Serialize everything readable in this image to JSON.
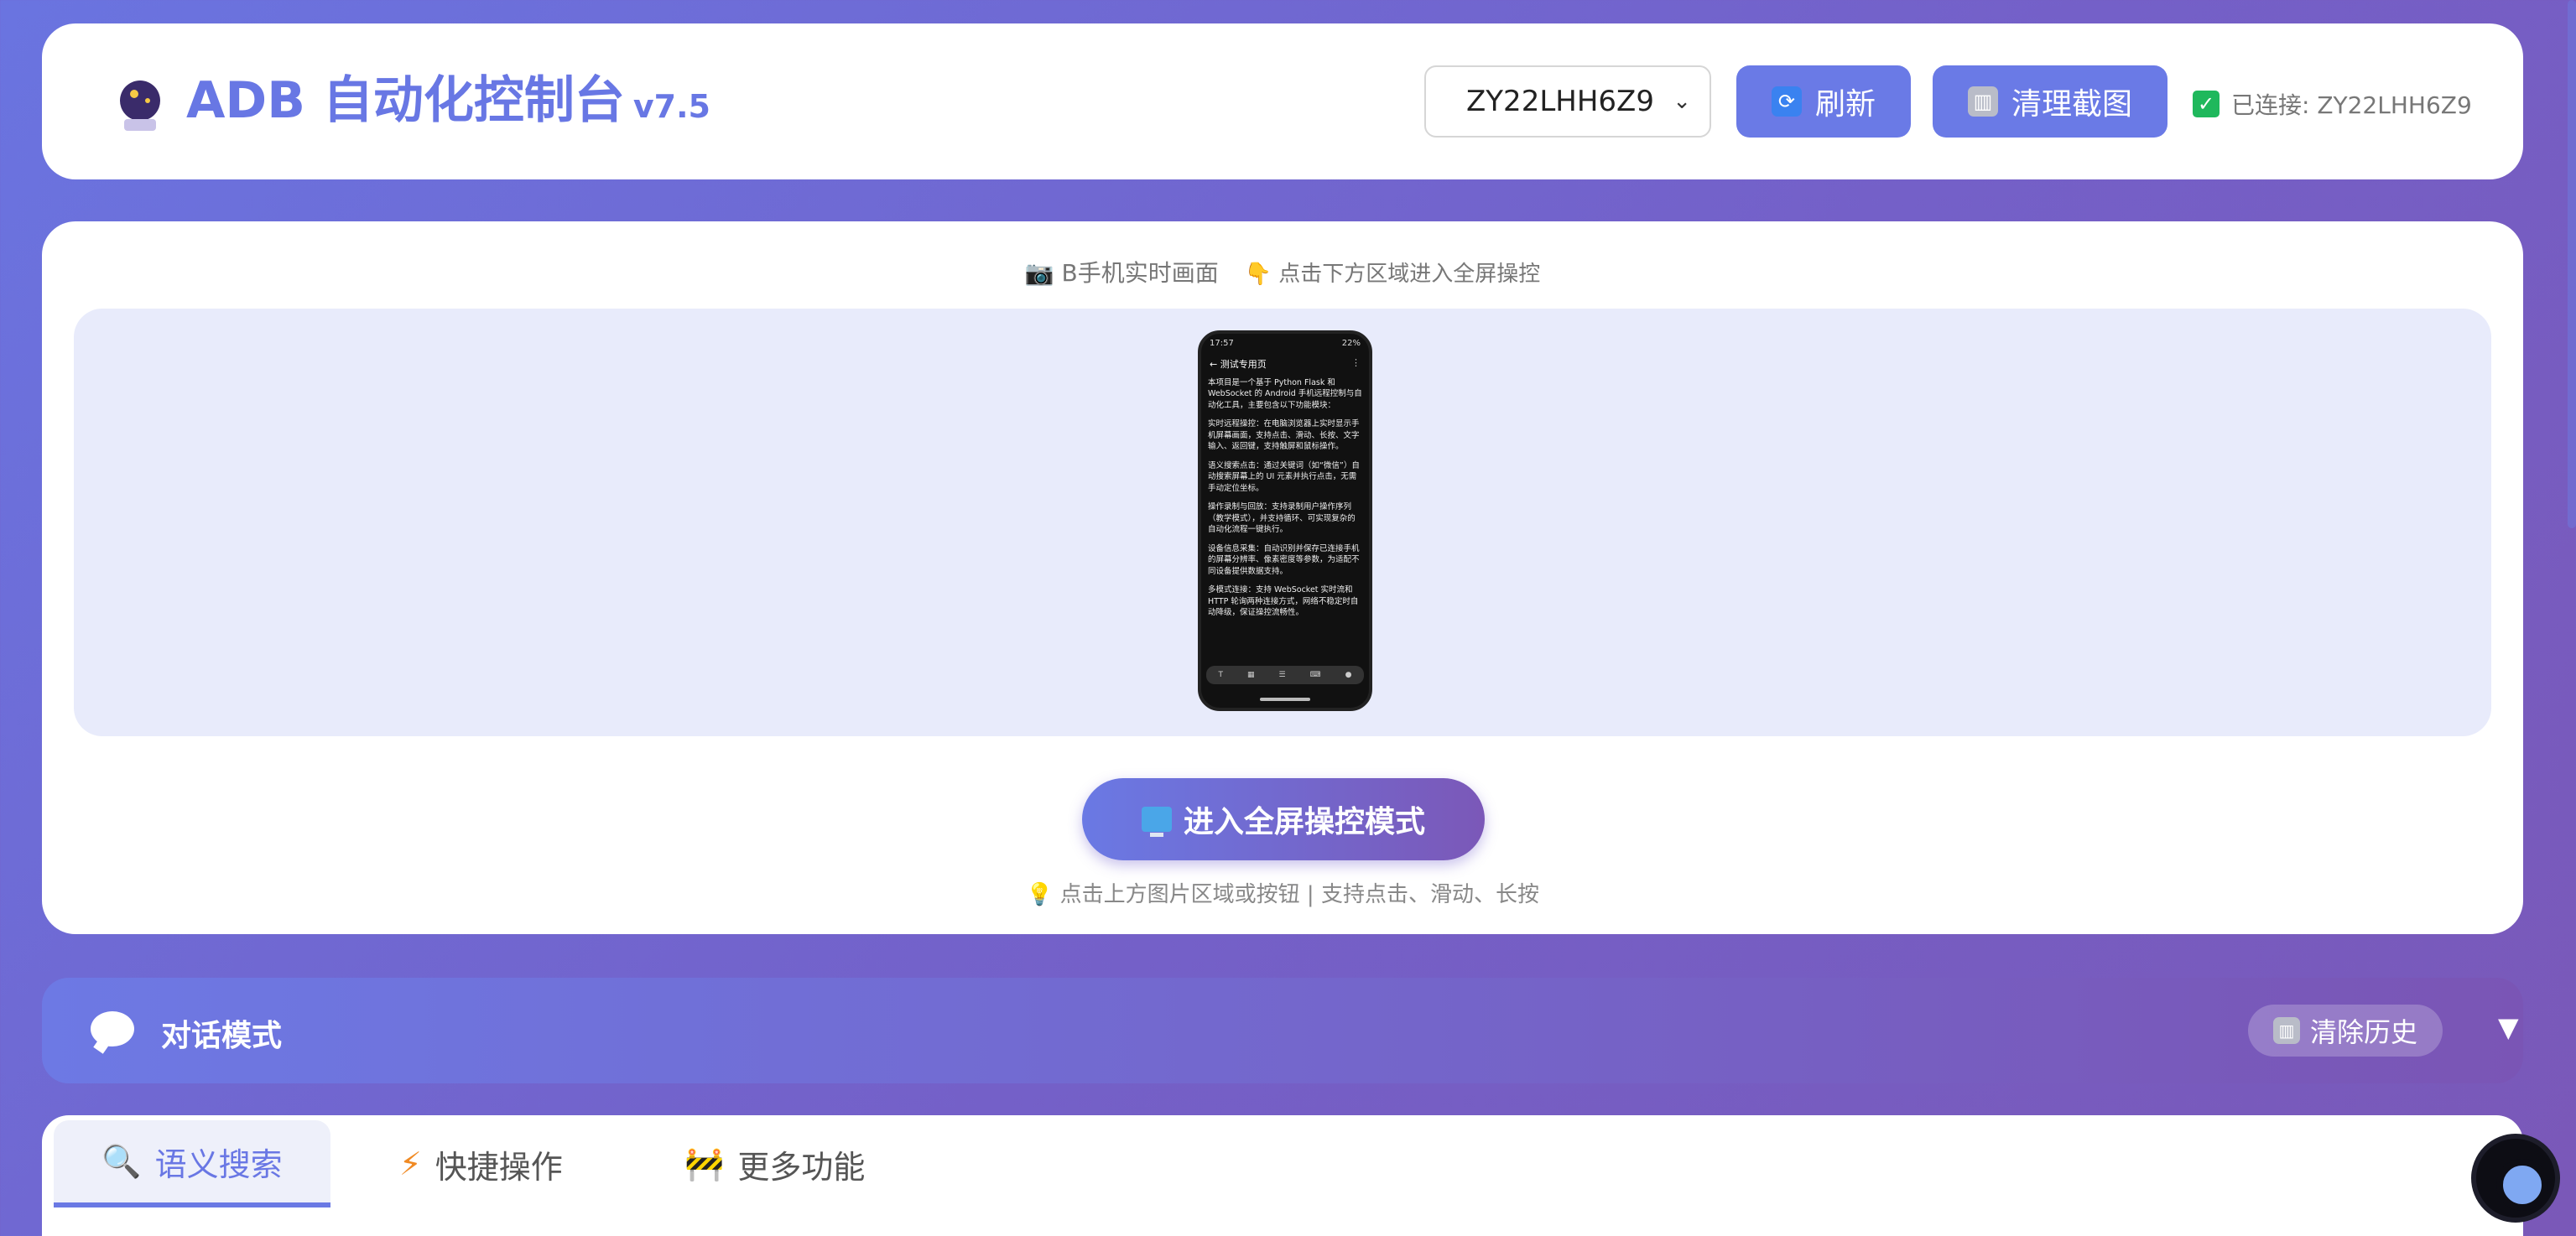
{
  "header": {
    "title": "ADB 自动化控制台",
    "version": "v7.5",
    "logo_icon": "crystal-ball-icon",
    "device_selected": "ZY22LHH6Z9",
    "refresh_label": "刷新",
    "clear_screenshots_label": "清理截图",
    "status_text": "已连接: ZY22LHH6Z9",
    "accent_color": "#6a7ae6",
    "status_color": "#1fb85c"
  },
  "live_view": {
    "caption": "B手机实时画面",
    "caption_hint": "点击下方区域进入全屏操控",
    "fullscreen_button": "进入全屏操控模式",
    "hint": "点击上方图片区域或按钮 | 支持点击、滑动、长按"
  },
  "phone_screen": {
    "time": "17:57",
    "battery": "22%",
    "page_title": "测试专用页",
    "paragraphs": [
      "本项目是一个基于 Python Flask 和 WebSocket 的 Android 手机远程控制与自动化工具，主要包含以下功能模块：",
      "实时远程操控：在电脑浏览器上实时显示手机屏幕画面，支持点击、滑动、长按、文字输入、返回键，支持触屏和鼠标操作。",
      "语义搜索点击：通过关键词（如“微信”）自动搜索屏幕上的 UI 元素并执行点击，无需手动定位坐标。",
      "操作录制与回放：支持录制用户操作序列（教学模式），并支持循环、可实现复杂的自动化流程一键执行。",
      "设备信息采集：自动识别并保存已连接手机的屏幕分辨率、像素密度等参数，为适配不同设备提供数据支持。",
      "多模式连接：支持 WebSocket 实时流和 HTTP 轮询两种连接方式，网络不稳定时自动降级，保证操控流畅性。"
    ]
  },
  "chat": {
    "title": "对话模式",
    "clear_history_label": "清除历史",
    "toggle": "▼"
  },
  "tabs": [
    {
      "label": "语义搜索",
      "icon": "magnifier-icon",
      "active": true
    },
    {
      "label": "快捷操作",
      "icon": "lightning-icon",
      "active": false
    },
    {
      "label": "更多功能",
      "icon": "construction-icon",
      "active": false
    }
  ]
}
